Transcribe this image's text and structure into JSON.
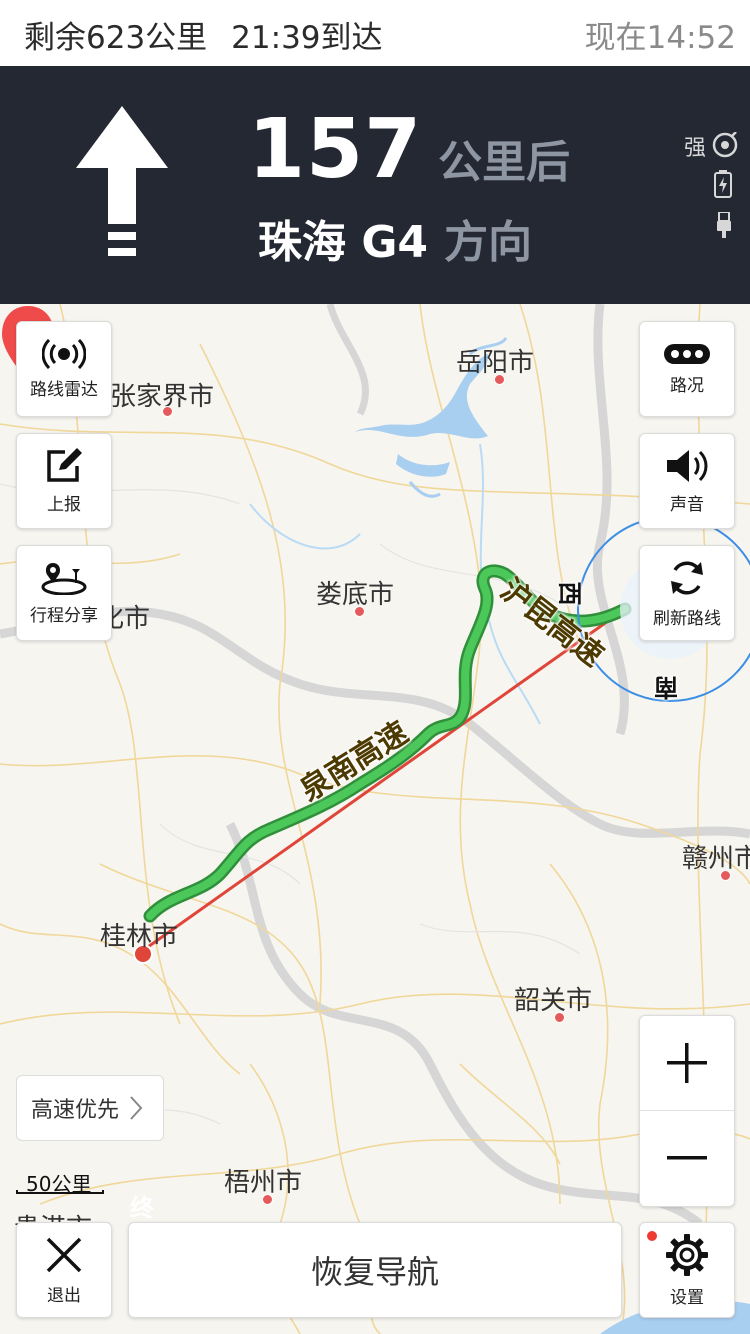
{
  "status": {
    "remaining": "剩余623公里",
    "arrival": "21:39到达",
    "now": "现在14:52"
  },
  "guide": {
    "distance_value": "157",
    "distance_unit": "公里后",
    "road_name": "珠海 G4",
    "road_direction": "方向",
    "gps_strength": "强",
    "maneuver_icon": "straight-arrow-icon"
  },
  "map": {
    "cities": {
      "yueyang": "岳阳市",
      "zhangjiajie": "张家界市",
      "loudi": "娄底市",
      "huaihua_partial": "化市",
      "ganzhou": "赣州市",
      "guilin": "桂林市",
      "shaoguan": "韶关市",
      "wuzhou": "梧州市",
      "guigang_partial": "贵港市"
    },
    "roads": {
      "quannan": "泉南高速",
      "hukun": "沪昆高速"
    },
    "compass": {
      "west": "西",
      "south": "南"
    },
    "end_marker": "终",
    "scale": "50公里"
  },
  "buttons": {
    "route_radar": "路线雷达",
    "report": "上报",
    "trip_share": "行程分享",
    "traffic": "路况",
    "sound": "声音",
    "refresh_route": "刷新路线",
    "route_pref": "高速优先",
    "exit": "退出",
    "resume": "恢复导航",
    "settings": "设置"
  },
  "colors": {
    "route_green": "#4cc75a",
    "route_red": "#e0453a",
    "accent_blue": "#3d8ee6",
    "panel_dark": "#232832"
  }
}
